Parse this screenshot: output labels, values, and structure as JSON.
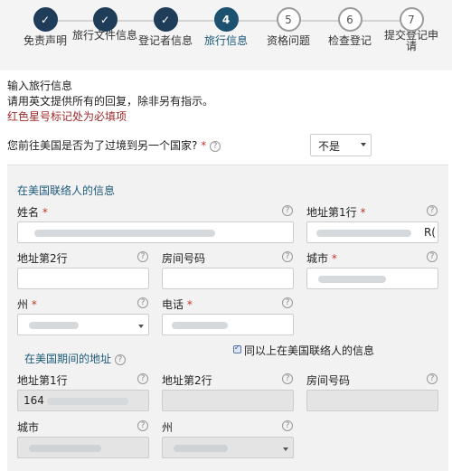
{
  "steps": [
    {
      "label": "免责声明",
      "status": "done",
      "number": ""
    },
    {
      "label": "旅行文件信息",
      "status": "done",
      "number": ""
    },
    {
      "label": "登记者信息",
      "status": "done",
      "number": ""
    },
    {
      "label": "旅行信息",
      "status": "current",
      "number": "4"
    },
    {
      "label": "资格问题",
      "status": "todo",
      "number": "5"
    },
    {
      "label": "检查登记",
      "status": "todo",
      "number": "6"
    },
    {
      "label": "提交登记申请",
      "status": "todo",
      "number": "7"
    }
  ],
  "intro": {
    "title": "输入旅行信息",
    "instruction": "请用英文提供所有的回复，除非另有指示。",
    "required_note": "红色星号标记处为必填项"
  },
  "question": {
    "text": "您前往美国是否为了过境到另一个国家?",
    "answer": "不是"
  },
  "contact": {
    "heading": "在美国联络人的信息",
    "name_label": "姓名",
    "address1_label": "地址第1行",
    "address1_value_tail": "R(",
    "address2_label": "地址第2行",
    "room_label": "房间号码",
    "city_label": "城市",
    "state_label": "州",
    "phone_label": "电话"
  },
  "stay": {
    "heading": "在美国期间的地址",
    "same_as_contact": "同以上在美国联络人的信息",
    "address1_label": "地址第1行",
    "address1_value": "164",
    "address2_label": "地址第2行",
    "room_label": "房间号码",
    "city_label": "城市",
    "state_label": "州"
  },
  "icons": {
    "help": "?",
    "check": "✓"
  },
  "colors": {
    "step_done": "#1f3c58",
    "step_current": "#1d5170",
    "required": "#c0392b",
    "section_heading": "#1d5a79"
  }
}
